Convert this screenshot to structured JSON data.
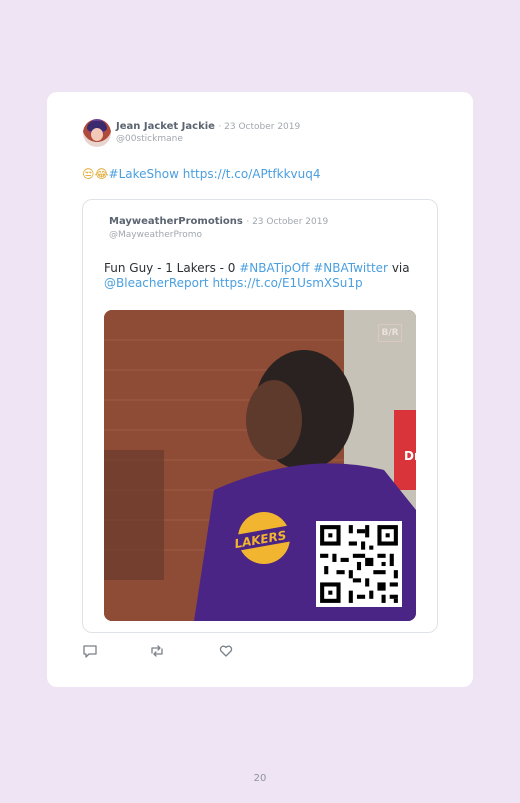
{
  "tweet": {
    "author_name": "Jean Jacket Jackie",
    "date": "· 23 October 2019",
    "handle": "@00stickmane",
    "emoji": "😒😂",
    "text": "#LakeShow https://t.co/APtfkkvuq4"
  },
  "quoted_tweet": {
    "author_name": "MayweatherPromotions",
    "date": "· 23 October 2019",
    "handle": "@MayweatherPromo",
    "text_plain": "Fun Guy - 1 Lakers - 0 ",
    "hashtag_1": "#NBATipOff",
    "hashtag_2": "#NBATwitter",
    "via": " via ",
    "mention": "@BleacherReport",
    "link": "https://t.co/E1UsmXSu1p",
    "media_watermark": "B/R",
    "media_jersey_text": "LAKERS"
  },
  "actions": {
    "reply_icon": "speech-bubble-icon",
    "retweet_icon": "retweet-icon",
    "like_icon": "heart-icon"
  },
  "colors": {
    "background": "#efe4f3",
    "link": "#4a9fe0",
    "jersey": "#4b2585",
    "lakers_gold": "#f2b530"
  },
  "page_number": "20"
}
